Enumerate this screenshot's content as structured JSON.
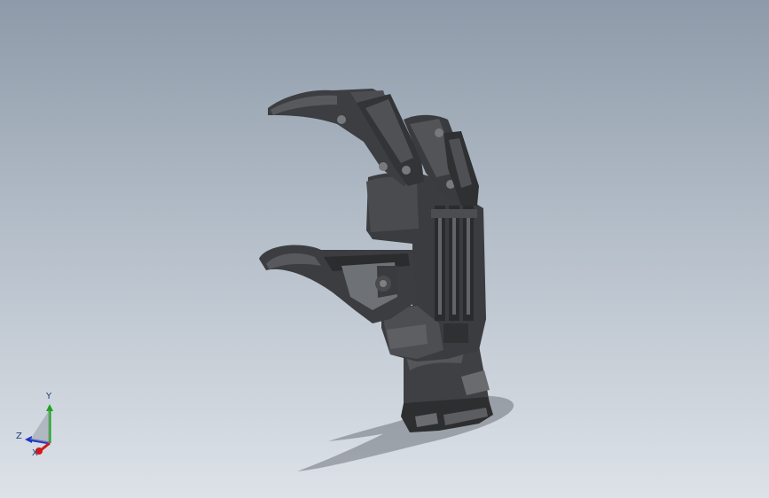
{
  "viewport": {
    "background_top": "#8e9aa9",
    "background_bottom": "#dde2e8",
    "model_color": "#3a3a3c"
  },
  "triad": {
    "x_label": "X",
    "y_label": "Y",
    "z_label": "Z",
    "x_color": "#d01a1a",
    "y_color": "#1aa31a",
    "z_color": "#1a35c9"
  }
}
